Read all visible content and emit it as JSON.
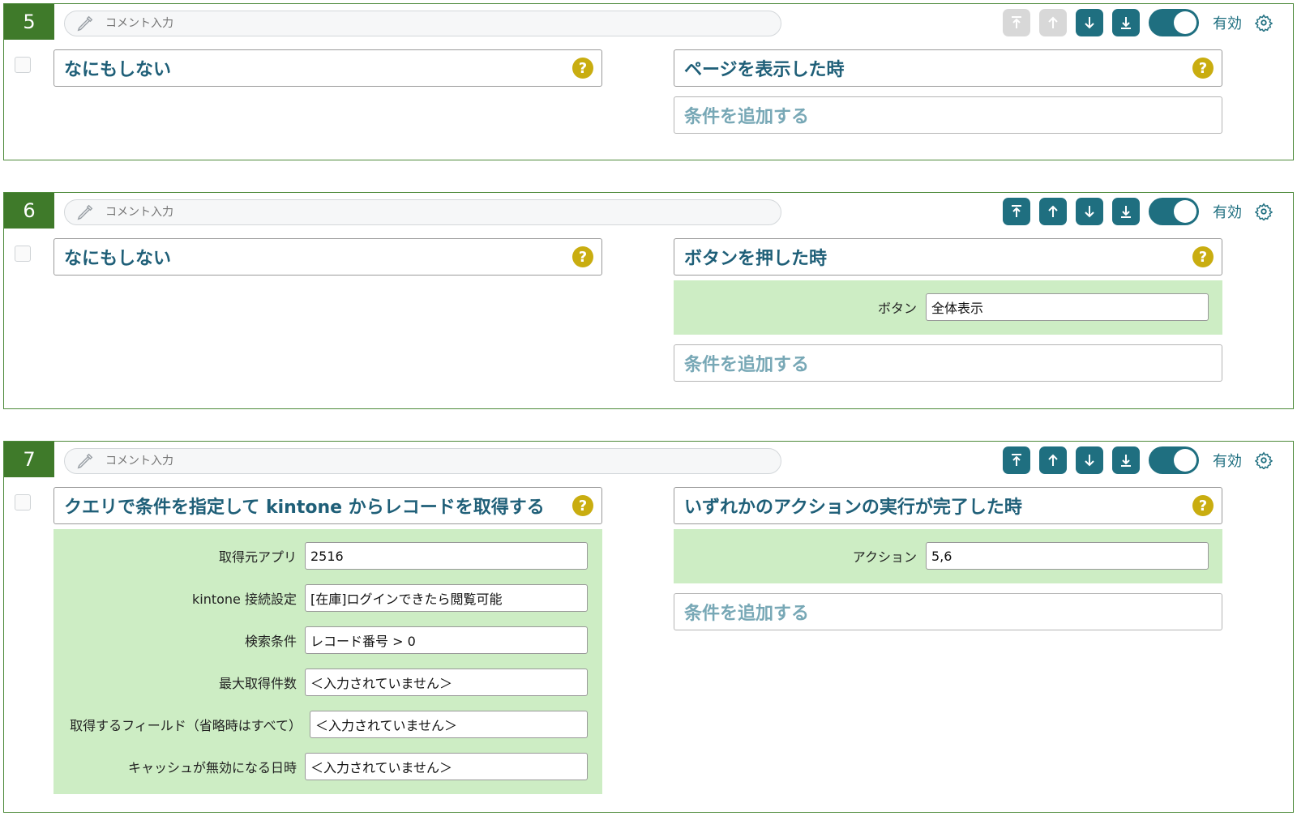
{
  "colors": {
    "header_green": "#3f7a2a",
    "teal": "#1f6f80",
    "help_yellow": "#c9ad10",
    "panel_green": "#cdedc4"
  },
  "icons": [
    "pencil-icon",
    "move-top-icon",
    "move-up-icon",
    "move-down-icon",
    "move-bottom-icon",
    "gear-icon",
    "help-icon"
  ],
  "comment_placeholder": "コメント入力",
  "enabled_label": "有効",
  "help_char": "?",
  "add_condition_label": "条件を追加する",
  "rules": [
    {
      "number": "5",
      "action": {
        "title": "なにもしない"
      },
      "trigger": {
        "title": "ページを表示した時"
      },
      "move_up_disabled": true
    },
    {
      "number": "6",
      "action": {
        "title": "なにもしない"
      },
      "trigger": {
        "title": "ボタンを押した時",
        "field_label": "ボタン",
        "field_value": "全体表示"
      }
    },
    {
      "number": "7",
      "action": {
        "title": "クエリで条件を指定して kintone からレコードを取得する",
        "fields": [
          {
            "label": "取得元アプリ",
            "value": "2516"
          },
          {
            "label": "kintone 接続設定",
            "value": "[在庫]ログインできたら閲覧可能"
          },
          {
            "label": "検索条件",
            "value": "レコード番号 > 0"
          },
          {
            "label": "最大取得件数",
            "value": "＜入力されていません＞"
          },
          {
            "label": "取得するフィールド（省略時はすべて）",
            "value": "＜入力されていません＞"
          },
          {
            "label": "キャッシュが無効になる日時",
            "value": "＜入力されていません＞"
          }
        ]
      },
      "trigger": {
        "title": "いずれかのアクションの実行が完了した時",
        "field_label": "アクション",
        "field_value": "5,6"
      }
    }
  ]
}
